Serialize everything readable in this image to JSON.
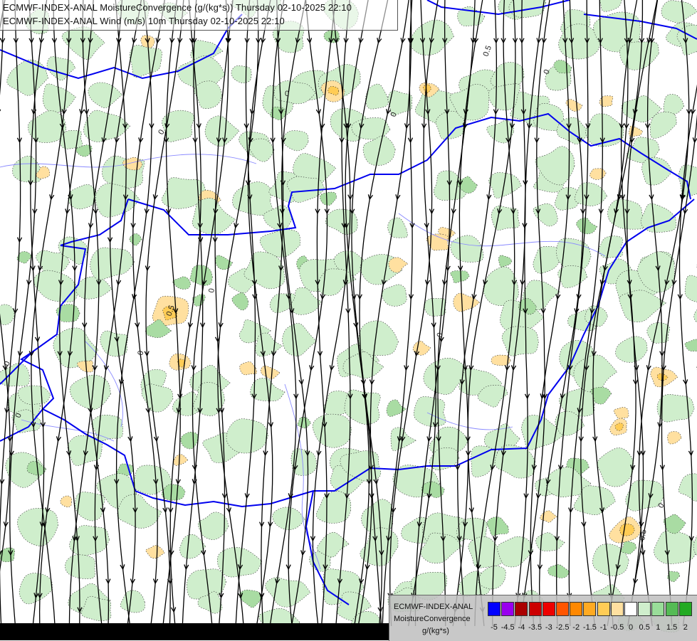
{
  "titles": {
    "line1": "ECMWF-INDEX-ANAL MoistureConvergence (g/(kg*s)) Thursday 02-10-2025 22:10",
    "line2": "ECMWF-INDEX-ANAL Wind (m/s) 10m Thursday 02-10-2025 22:10"
  },
  "legend": {
    "line1": "ECMWF-INDEX-ANAL",
    "line2": "MoistureConvergence",
    "unit": "g/(kg*s)",
    "colors": [
      "#0000ff",
      "#9900ee",
      "#aa0000",
      "#cc0000",
      "#ee0000",
      "#ff5500",
      "#ff8800",
      "#ffaa22",
      "#ffcc55",
      "#ffe0a0",
      "#ffffff",
      "#cfeecc",
      "#99dd99",
      "#55bb55",
      "#22aa22"
    ],
    "ticks": [
      "-5",
      "-4.5",
      "-4",
      "-3.5",
      "-3",
      "-2.5",
      "-2",
      "-1.5",
      "-1",
      "-0.5",
      "0",
      "0.5",
      "1",
      "1.5",
      "2"
    ]
  },
  "map_labels": {
    "zero": "0",
    "plus_half": "0.5",
    "minus_half": "-0.5"
  },
  "map_colors": {
    "green_fill": "#cfeecc",
    "green_dark": "#a9dca3",
    "orange_fill": "#ffe0a0",
    "orange_dark": "#ffcc55",
    "border_national": "#0000ee",
    "river": "#8a8aff",
    "streamline": "#000000"
  }
}
